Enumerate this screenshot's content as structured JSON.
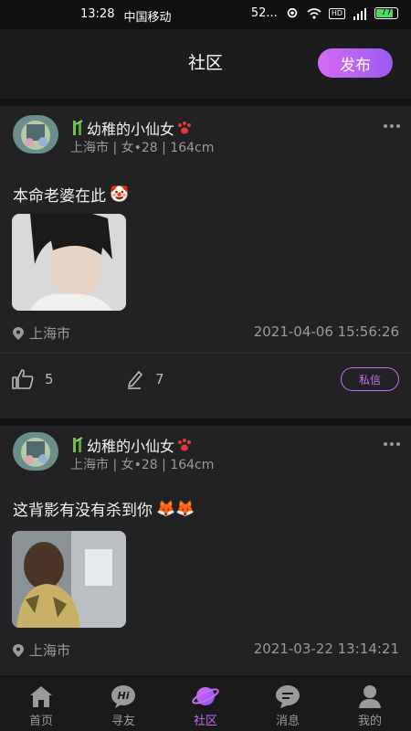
{
  "status_bar": {
    "time": "13:28",
    "carrier": "中国移动",
    "speed": "52...",
    "battery": "77"
  },
  "header": {
    "title": "社区",
    "publish_label": "发布"
  },
  "posts": [
    {
      "username": "幼稚的小仙女",
      "meta": "上海市 | 女•28 | 164cm",
      "content": "本命老婆在此",
      "content_emoji": "🤡",
      "location": "上海市",
      "time": "2021-04-06 15:56:26",
      "likes": "5",
      "comments": "7",
      "dm_label": "私信"
    },
    {
      "username": "幼稚的小仙女",
      "meta": "上海市 | 女•28 | 164cm",
      "content": "这背影有没有杀到你",
      "content_emoji": "🦊🦊",
      "location": "上海市",
      "time": "2021-03-22 13:14:21"
    }
  ],
  "tabs": [
    {
      "label": "首页",
      "icon": "home-icon"
    },
    {
      "label": "寻友",
      "icon": "hi-chat-icon"
    },
    {
      "label": "社区",
      "icon": "planet-icon",
      "active": true
    },
    {
      "label": "消息",
      "icon": "message-icon"
    },
    {
      "label": "我的",
      "icon": "profile-icon"
    }
  ],
  "colors": {
    "accent": "#c56ef0",
    "background": "#1c1c1e",
    "card": "#222224"
  }
}
